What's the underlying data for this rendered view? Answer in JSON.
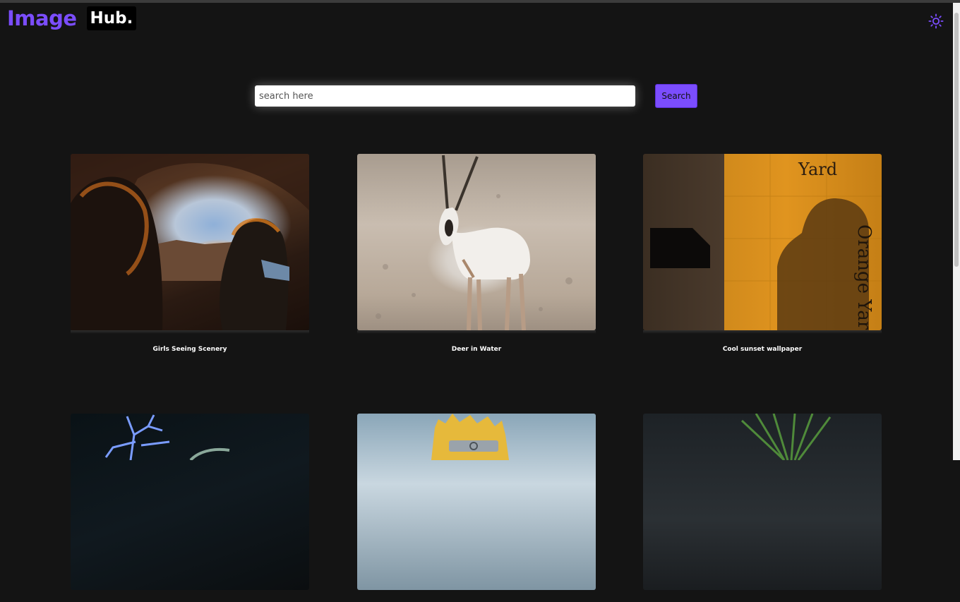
{
  "header": {
    "logo_primary": "Image",
    "logo_secondary": "Hub.",
    "theme_toggle_icon": "sun-icon"
  },
  "search": {
    "placeholder": "search here",
    "value": "",
    "button_label": "Search"
  },
  "gallery": [
    {
      "caption": "Girls Seeing Scenery"
    },
    {
      "caption": "Deer in Water"
    },
    {
      "caption": "Cool sunset wallpaper"
    },
    {
      "caption": ""
    },
    {
      "caption": ""
    },
    {
      "caption": ""
    }
  ],
  "image_text": {
    "sign_top": "Yard",
    "sign_side": "Orange Yard"
  },
  "colors": {
    "accent": "#7b4dff",
    "background": "#141414"
  }
}
